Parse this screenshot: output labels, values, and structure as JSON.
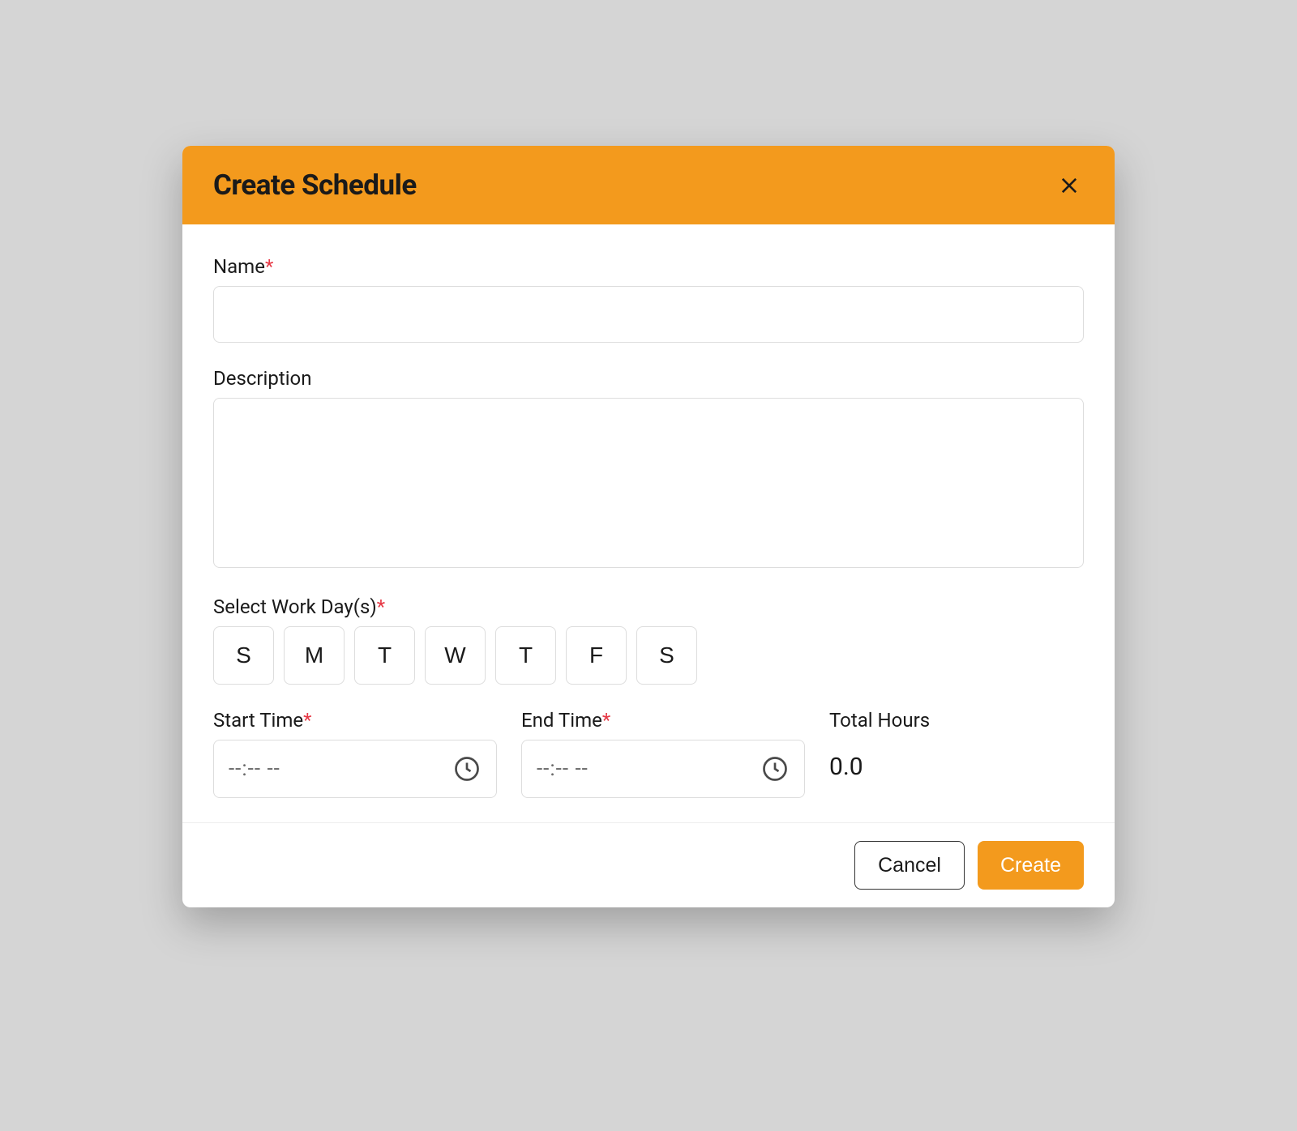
{
  "modal": {
    "title": "Create Schedule"
  },
  "form": {
    "name_label": "Name",
    "name_value": "",
    "description_label": "Description",
    "description_value": "",
    "workdays_label": "Select Work Day(s)",
    "days": [
      "S",
      "M",
      "T",
      "W",
      "T",
      "F",
      "S"
    ],
    "start_time_label": "Start Time",
    "start_time_placeholder": "--:-- --",
    "end_time_label": "End Time",
    "end_time_placeholder": "--:-- --",
    "total_hours_label": "Total Hours",
    "total_hours_value": "0.0"
  },
  "footer": {
    "cancel_label": "Cancel",
    "create_label": "Create"
  },
  "colors": {
    "accent": "#f39a1d",
    "required": "#e63946"
  }
}
